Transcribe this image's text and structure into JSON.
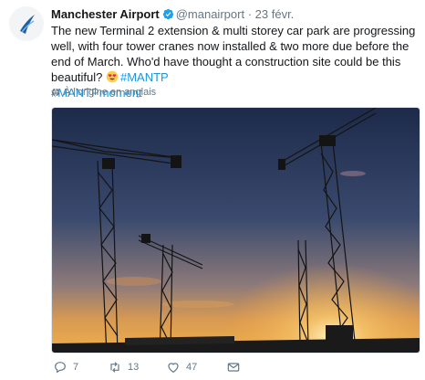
{
  "tweet": {
    "author_name": "Manchester Airport",
    "handle": "@manairport",
    "separator": "·",
    "date": "23 févr.",
    "text_part1": "The new Terminal 2 extension & multi storey car park are progressing well, with four tower cranes now installed & two more due before the end of March. Who'd have thought a construction site could be this beautiful? ",
    "hashtag1": "#MANTP",
    "hashtag2": "#MANTPmoment",
    "translate_label": "À l'origine en anglais"
  },
  "actions": {
    "reply_count": "7",
    "retweet_count": "13",
    "like_count": "47"
  },
  "colors": {
    "link": "#1b95e0",
    "muted": "#657786",
    "verified": "#1da1f2"
  },
  "icons": [
    "verified-icon",
    "emoji-heart-eyes-icon",
    "globe-icon",
    "reply-icon",
    "retweet-icon",
    "like-icon",
    "message-icon"
  ]
}
